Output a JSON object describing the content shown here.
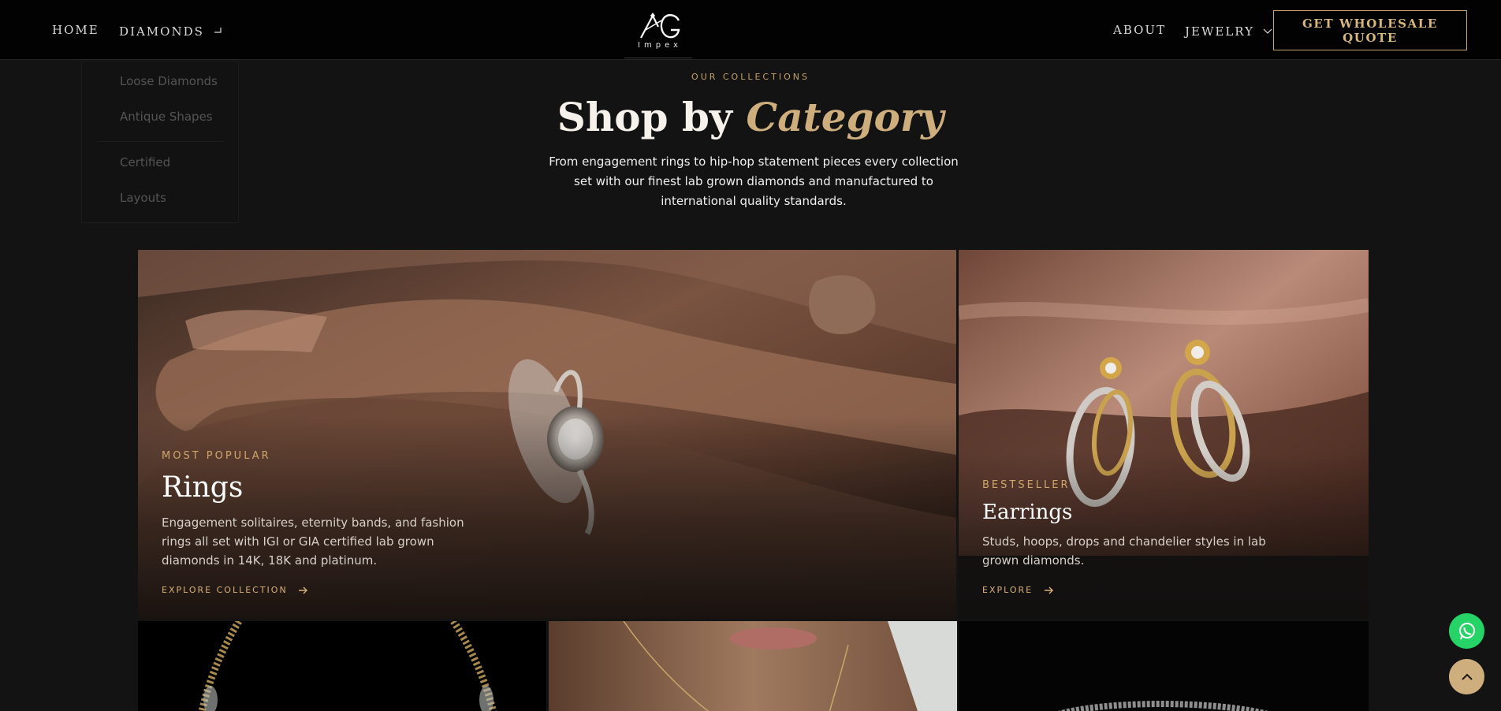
{
  "nav": {
    "home": "HOME",
    "diamonds": "DIAMONDS",
    "about": "ABOUT",
    "jewelry": "JEWELRY",
    "quote_button": "GET WHOLESALE QUOTE"
  },
  "logo": {
    "sub": "Impex"
  },
  "dropdown": {
    "items": [
      "Loose Diamonds",
      "Antique Shapes",
      "Certified",
      "Layouts"
    ]
  },
  "section": {
    "eyebrow": "OUR COLLECTIONS",
    "heading_main": "Shop by",
    "heading_accent": "Category",
    "lead": "From engagement rings to hip-hop statement pieces every collection set with our finest lab grown diamonds and manufactured to international quality standards."
  },
  "cards": {
    "rings": {
      "tag": "MOST POPULAR",
      "title": "Rings",
      "desc": "Engagement solitaires, eternity bands, and fashion rings all set with IGI or GIA certified lab grown diamonds in 14K, 18K and platinum.",
      "cta": "EXPLORE COLLECTION"
    },
    "earrings": {
      "tag": "BESTSELLER",
      "title": "Earrings",
      "desc": "Studs, hoops, drops and chandelier styles in lab grown diamonds.",
      "cta": "EXPLORE"
    }
  },
  "colors": {
    "accent": "#cfae7d",
    "background": "#131313",
    "nav_background": "#020202",
    "whatsapp": "#25d366"
  },
  "icons": {
    "diamonds_chevron": "chevron-down-icon",
    "jewelry_chevron": "chevron-down-icon",
    "explore_arrow": "arrow-right-icon",
    "whatsapp": "whatsapp-icon",
    "back_to_top": "chevron-up-icon"
  }
}
